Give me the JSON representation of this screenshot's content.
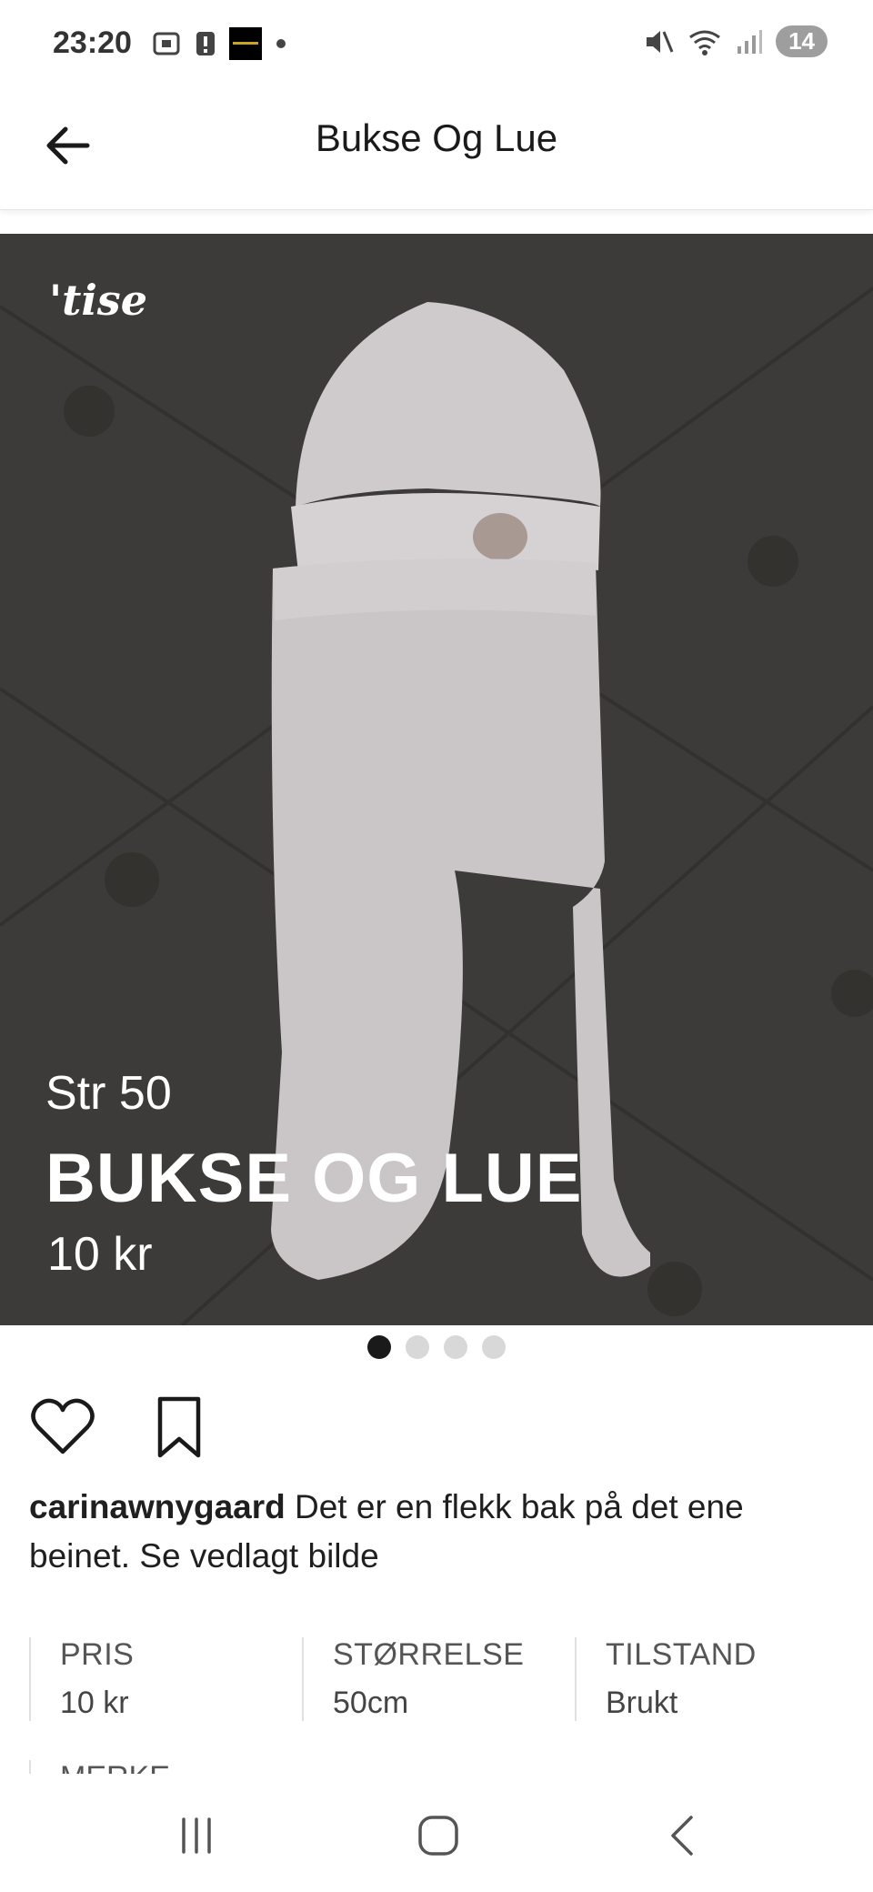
{
  "status": {
    "time": "23:20",
    "battery_badge": "14"
  },
  "header": {
    "title": "Bukse Og Lue"
  },
  "image": {
    "overlay_size": "Str 50",
    "overlay_title": "BUKSE OG LUE",
    "overlay_price": "10 kr",
    "watermark": "'tise",
    "page_count": 4,
    "active_page": 1
  },
  "post": {
    "username": "carinawnygaard",
    "description": " Det er en flekk bak på det ene beinet. Se vedlagt bilde"
  },
  "details": [
    {
      "label": "PRIS",
      "value": "10 kr"
    },
    {
      "label": "STØRRELSE",
      "value": "50cm"
    },
    {
      "label": "TILSTAND",
      "value": "Brukt"
    }
  ],
  "next_detail_label": "MERKE",
  "colors": {
    "accent": "#1a1a1a",
    "image_bg": "#3c3b39"
  }
}
